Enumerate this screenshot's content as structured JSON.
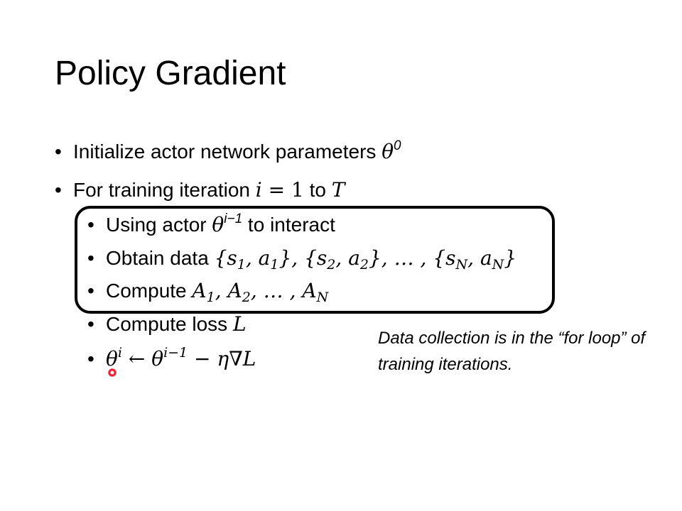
{
  "title": "Policy Gradient",
  "bullets": {
    "init": {
      "text": "Initialize actor network parameters ",
      "math": "θ",
      "sup": "0"
    },
    "loop": {
      "text": "For training iteration ",
      "math_a": "i",
      "math_eq": " = 1",
      "mid": " to ",
      "math_b": "T"
    },
    "sub": {
      "use_actor": {
        "before": "Using actor ",
        "math": "θ",
        "sup": "i−1",
        "after": " to interact"
      },
      "obtain": {
        "text": "Obtain data ",
        "math": "{s₁, a₁}, {s₂, a₂}, … , {s_N, a_N}"
      },
      "compute_a": {
        "text": "Compute ",
        "math": "A₁, A₂, … , A_N"
      },
      "compute_loss": {
        "text": "Compute loss ",
        "math": "L"
      },
      "update": {
        "math": "θⁱ ← θⁱ⁻¹ − η∇L"
      }
    }
  },
  "note": "Data collection is in the “for loop” of training iterations.",
  "colors": {
    "box_border": "#000000",
    "cursor": "#ee1c2e"
  }
}
